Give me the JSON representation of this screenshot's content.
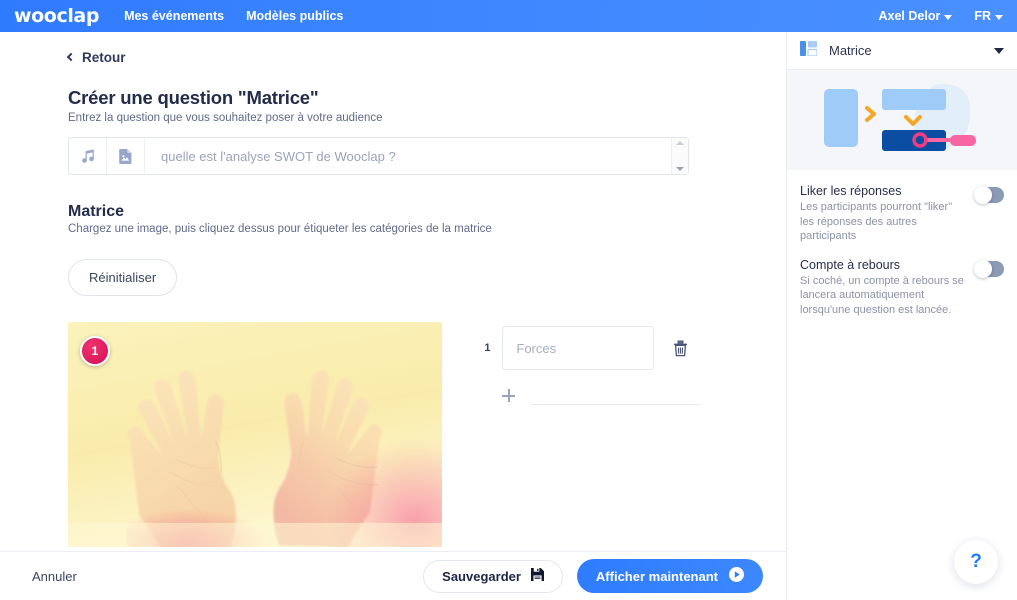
{
  "navbar": {
    "brand": "wooclap",
    "links": [
      {
        "label": "Mes événements"
      },
      {
        "label": "Modèles publics"
      }
    ],
    "user": {
      "label": "Axel Delor"
    },
    "language": {
      "label": "FR"
    },
    "accent": "#3d86ff"
  },
  "content": {
    "back_label": "Retour",
    "title": "Créer une question \"Matrice\"",
    "subtitle": "Entrez la question que vous souhaitez poser à votre audience",
    "question_input": {
      "value": "",
      "placeholder": "quelle est l'analyse SWOT de Wooclap ?",
      "audio_icon": "music-note-icon",
      "image_icon": "image-file-icon"
    },
    "matrix": {
      "title": "Matrice",
      "subtitle": "Chargez une image, puis cliquez dessus pour étiqueter les catégories de la matrice",
      "reset_label": "Réinitialiser",
      "image": {
        "alt": "deux mains ouvertes sur fond jaune",
        "background": "#f9eeae"
      },
      "markers": [
        {
          "number": "1",
          "color": "#d9185c"
        }
      ],
      "labels": [
        {
          "number": "1",
          "value": "",
          "placeholder": "Forces",
          "delete_icon": "trash-icon"
        }
      ],
      "add_icon": "plus-icon"
    }
  },
  "bottombar": {
    "cancel_label": "Annuler",
    "save_label": "Sauvegarder",
    "save_icon": "floppy-disk-icon",
    "show_label": "Afficher maintenant",
    "show_icon": "play-circle-icon",
    "primary": "#2e7cfd"
  },
  "sidebar": {
    "header": {
      "title": "Matrice",
      "icon": "matrix-layout-icon",
      "caret": "chevron-down-icon"
    },
    "preview": {
      "alt": "aperçu du type de question matrice"
    },
    "options": [
      {
        "title": "Liker les réponses",
        "desc": "Les participants pourront \"liker\" les réponses des autres participants",
        "enabled": false
      },
      {
        "title": "Compte à rebours",
        "desc": "Si coché, un compte à rebours se lancera automatiquement lorsqu'une question est lancée.",
        "enabled": false
      }
    ],
    "help": {
      "label": "?"
    }
  }
}
